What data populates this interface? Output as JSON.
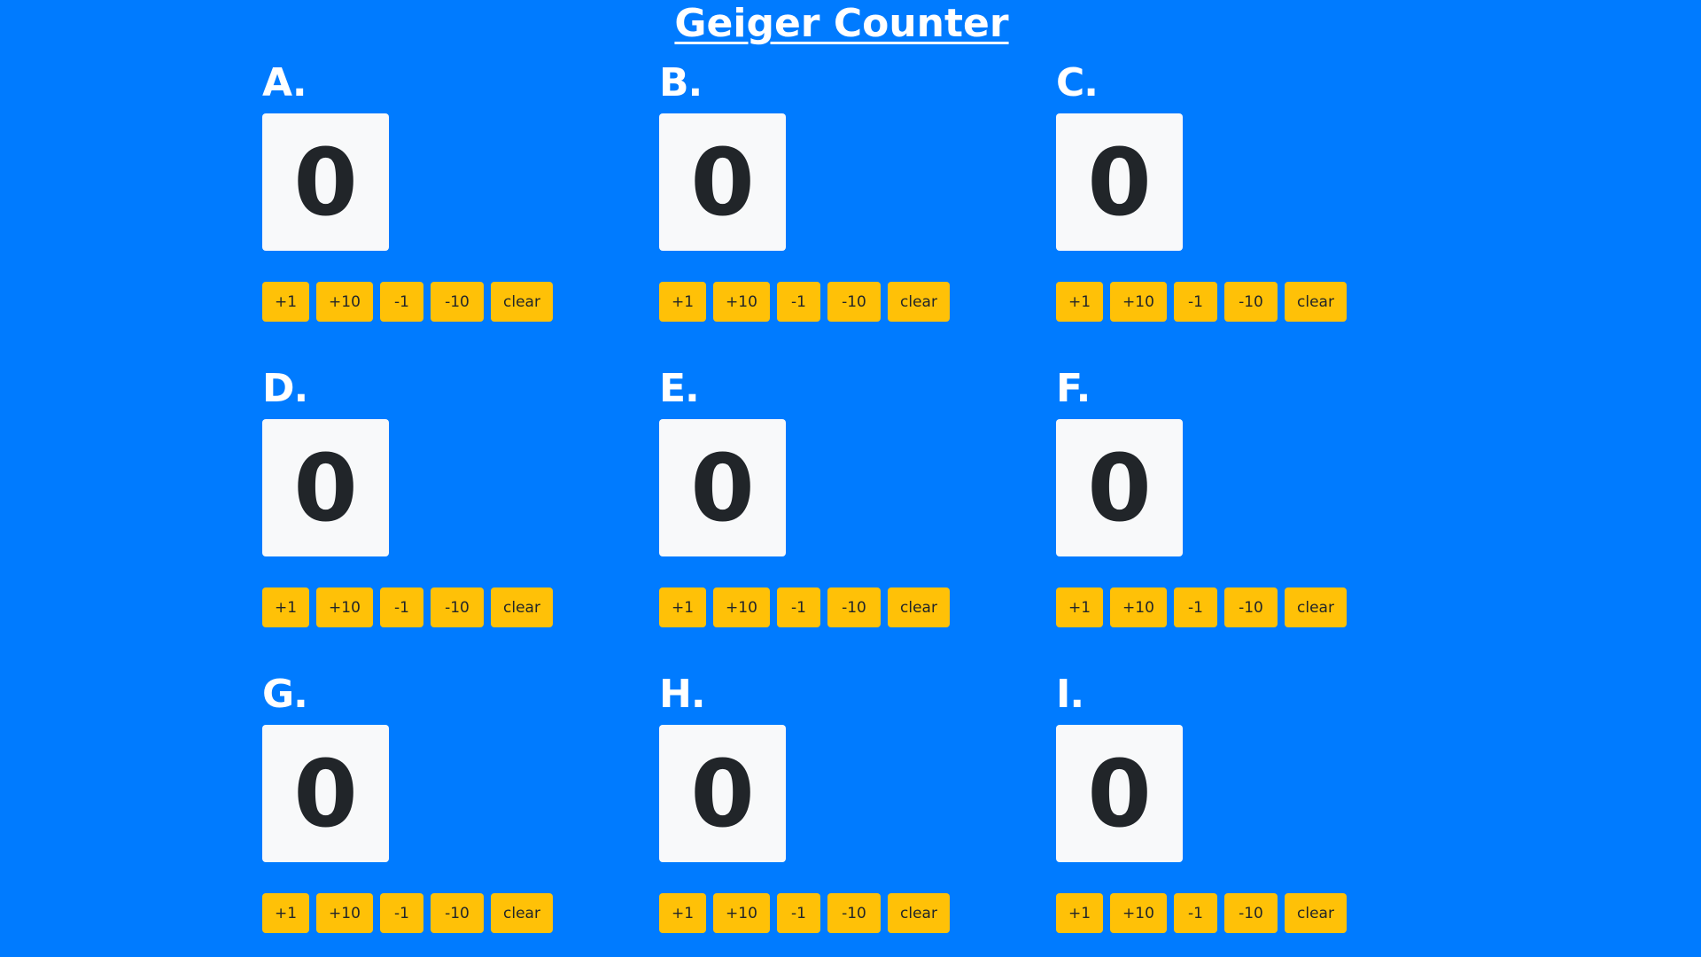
{
  "title": "Geiger Counter",
  "colors": {
    "background": "#007bff",
    "display_bg": "#f8f9fa",
    "display_text": "#212529",
    "button_bg": "#ffc107",
    "button_text": "#212529"
  },
  "button_labels": {
    "plus1": "+1",
    "plus10": "+10",
    "minus1": "-1",
    "minus10": "-10",
    "clear": "clear"
  },
  "counters": [
    {
      "label": "A.",
      "value": "0"
    },
    {
      "label": "B.",
      "value": "0"
    },
    {
      "label": "C.",
      "value": "0"
    },
    {
      "label": "D.",
      "value": "0"
    },
    {
      "label": "E.",
      "value": "0"
    },
    {
      "label": "F.",
      "value": "0"
    },
    {
      "label": "G.",
      "value": "0"
    },
    {
      "label": "H.",
      "value": "0"
    },
    {
      "label": "I.",
      "value": "0"
    }
  ]
}
